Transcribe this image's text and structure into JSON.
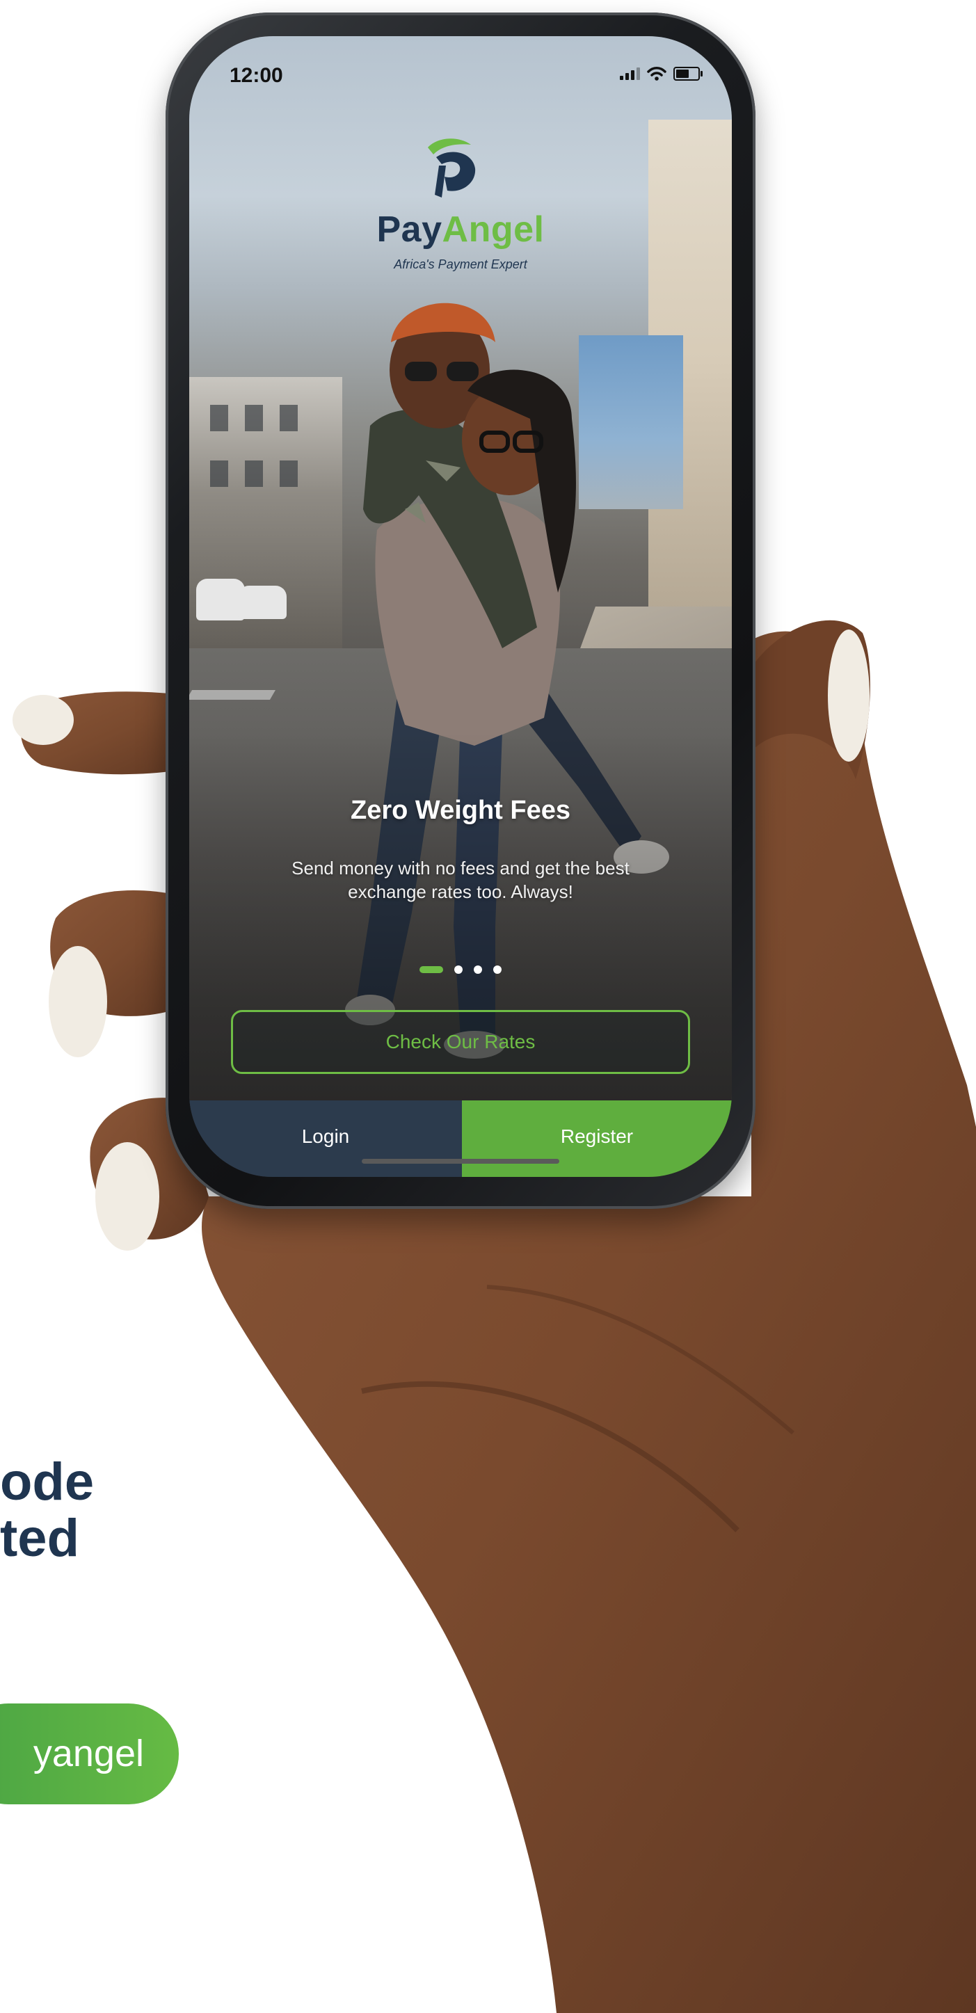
{
  "status_bar": {
    "time": "12:00"
  },
  "app": {
    "brand_part1": "Pay",
    "brand_part2": "Angel",
    "tagline": "Africa's Payment Expert"
  },
  "slide": {
    "title": "Zero Weight Fees",
    "body": "Send money with no fees and get the best exchange rates too. Always!",
    "dots_total": 4,
    "active_dot": 1
  },
  "buttons": {
    "check_rates": "Check Our Rates",
    "login": "Login",
    "register": "Register"
  },
  "marketing": {
    "headline_line1": "ode",
    "headline_line2": "ted",
    "pill_text": "yangel"
  },
  "colors": {
    "brand_green": "#6ebd45",
    "brand_navy": "#1f3550",
    "register_green": "#5fae3e",
    "login_navy": "#2c3b4d"
  }
}
